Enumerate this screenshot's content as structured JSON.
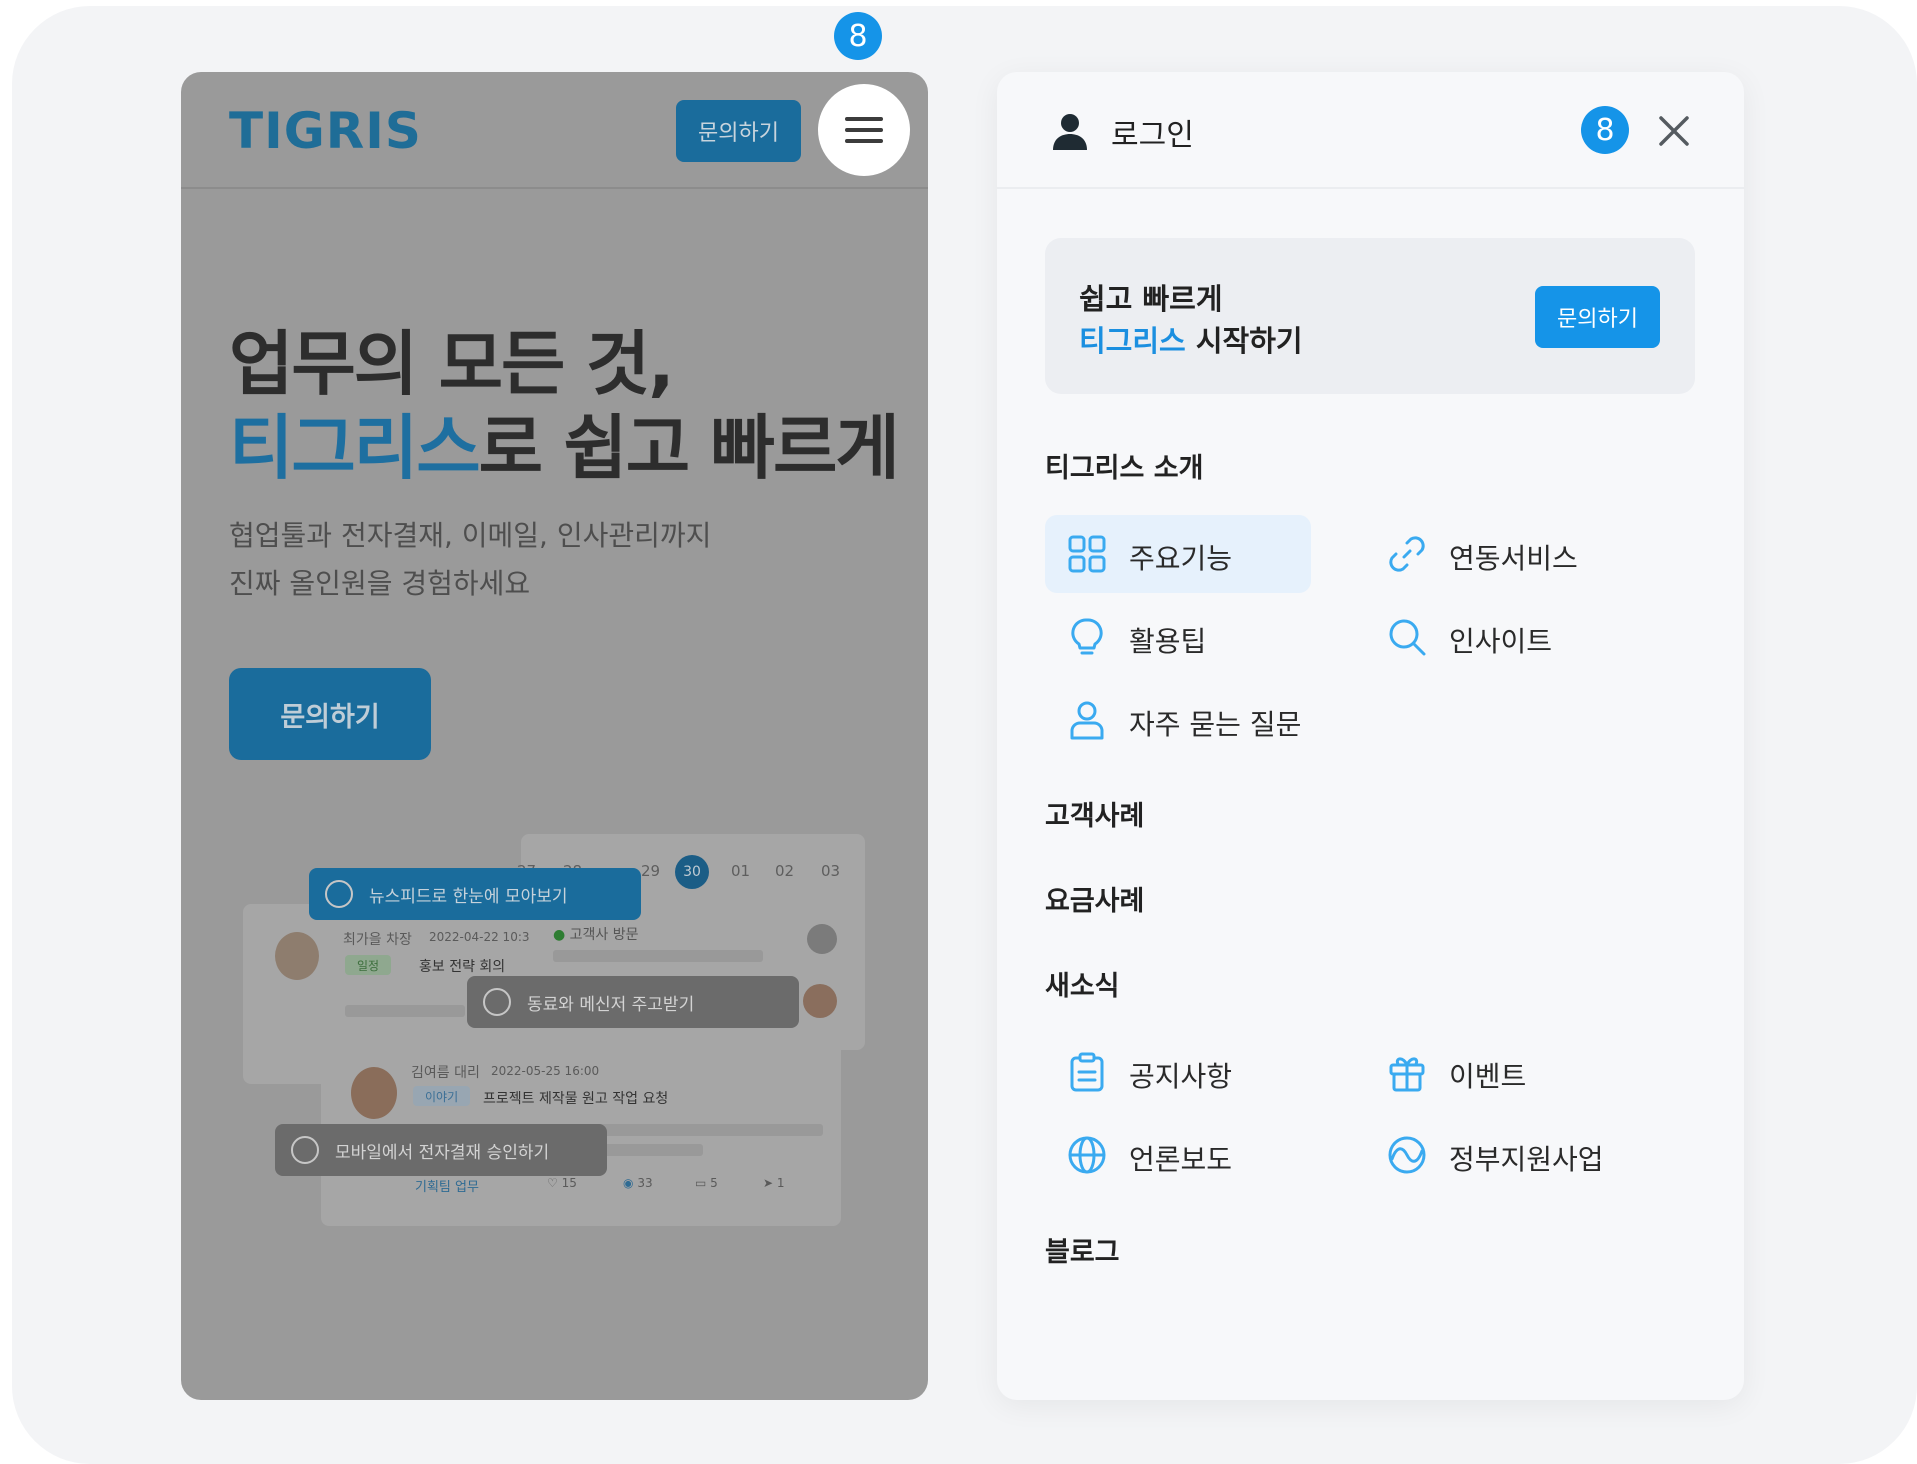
{
  "badge_number": "8",
  "phone": {
    "logo": "TIGRIS",
    "header_button": "문의하기",
    "hero": {
      "title_line1": "업무의 모든 것,",
      "title_line2_blue": "티그리스",
      "title_line2_rest": "로 쉽고 빠르게",
      "subtitle_line1": "협업툴과 전자결재, 이메일, 인사관리까지",
      "subtitle_line2": "진짜 올인원을 경험하세요",
      "button": "문의하기"
    },
    "preview": {
      "dates": [
        "27",
        "28",
        "29",
        "30",
        "01",
        "02",
        "03"
      ],
      "selected_date": "30",
      "pill_newsfeed": "뉴스피드로 한눈에 모아보기",
      "pill_messenger": "동료와 메신저 주고받기",
      "pill_approval": "모바일에서 전자결재 승인하기",
      "post1_author": "최가을 차장",
      "post1_date": "2022-04-22 10:3",
      "post1_tag": "일정",
      "post1_title": "홍보 전략 회의",
      "visit_label": "고객사 방문",
      "post2_author": "김여름 대리",
      "post2_date": "2022-05-25 16:00",
      "post2_tag": "이야기",
      "post2_title": "프로젝트 제작물 원고 작업 요청",
      "post2_team": "기획팀 업무",
      "stat_likes": "15",
      "stat_views": "33",
      "stat_comments": "5",
      "stat_shares": "1"
    }
  },
  "panel": {
    "login_label": "로그인",
    "promo": {
      "line1": "쉽고 빠르게",
      "line2_blue": "티그리스",
      "line2_rest": " 시작하기",
      "button": "문의하기"
    },
    "sections": {
      "intro": "티그리스 소개",
      "cases": "고객사례",
      "pricing": "요금사례",
      "news": "새소식",
      "blog": "블로그"
    },
    "intro_items": [
      {
        "label": "주요기능",
        "icon": "grid-icon"
      },
      {
        "label": "연동서비스",
        "icon": "link-icon"
      },
      {
        "label": "활용팁",
        "icon": "lightbulb-icon"
      },
      {
        "label": "인사이트",
        "icon": "search-icon"
      },
      {
        "label": "자주 묻는 질문",
        "icon": "person-icon"
      }
    ],
    "news_items": [
      {
        "label": "공지사항",
        "icon": "clipboard-icon"
      },
      {
        "label": "이벤트",
        "icon": "gift-icon"
      },
      {
        "label": "언론보도",
        "icon": "globe-icon"
      },
      {
        "label": "정부지원사업",
        "icon": "support-icon"
      }
    ]
  },
  "colors": {
    "accent": "#1594e8",
    "overlay": "#9a9a9a",
    "icon_blue": "#3aaaf0"
  }
}
